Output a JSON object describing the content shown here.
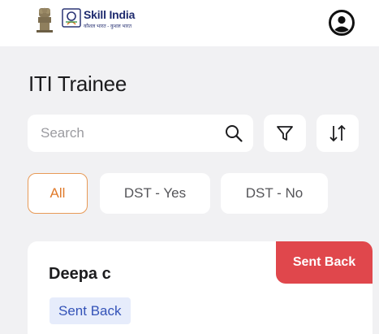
{
  "header": {
    "brand_title": "Skill India",
    "brand_tagline": "कौशल भारत - कुशल भारत",
    "emblem_icon": "national-emblem-icon",
    "logo_icon": "skill-india-logo-icon",
    "profile_icon": "account-circle-icon"
  },
  "page": {
    "title": "ITI Trainee"
  },
  "search": {
    "placeholder": "Search",
    "value": "",
    "icon": "search-icon"
  },
  "toolbar": {
    "filter_icon": "filter-icon",
    "sort_icon": "sort-icon"
  },
  "filters": [
    {
      "label": "All",
      "selected": true
    },
    {
      "label": "DST - Yes",
      "selected": false
    },
    {
      "label": "DST - No",
      "selected": false
    }
  ],
  "trainees": [
    {
      "name": "Deepa c",
      "ribbon": "Sent Back",
      "status": "Sent Back"
    }
  ],
  "colors": {
    "background": "#f1f1f3",
    "accent_orange": "#e07a2a",
    "ribbon_red": "#e0474c",
    "badge_bg": "#e6ecfb",
    "badge_text": "#3453b8",
    "brand_navy": "#1e2a6e"
  }
}
